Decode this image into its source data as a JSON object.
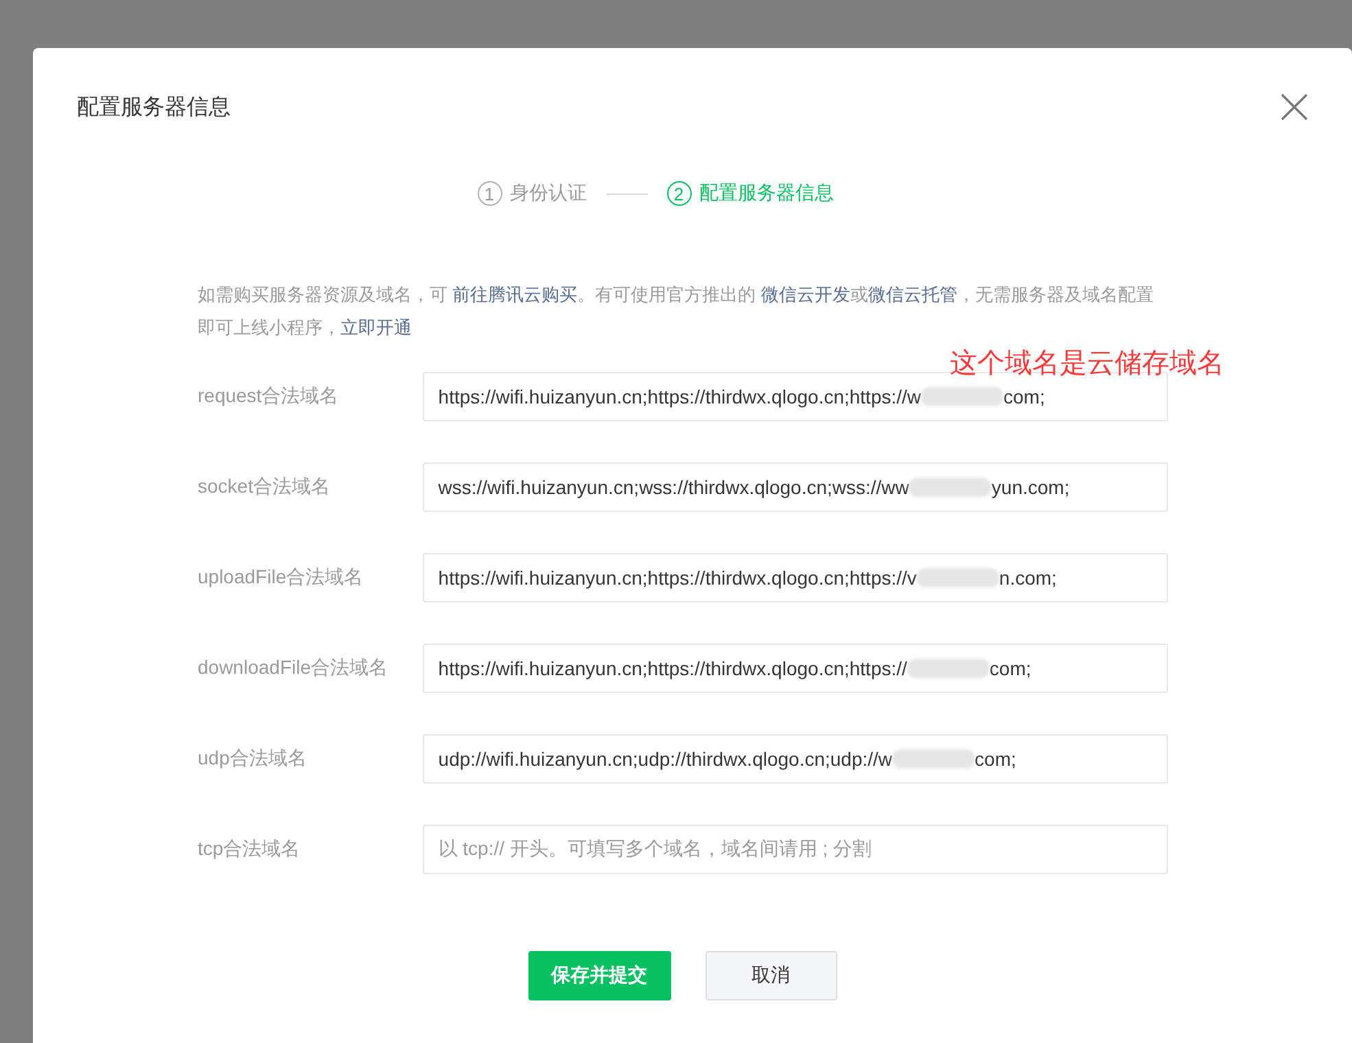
{
  "dialog": {
    "title": "配置服务器信息",
    "steps": [
      {
        "number": "1",
        "label": "身份认证",
        "selected": false
      },
      {
        "number": "2",
        "label": "配置服务器信息",
        "selected": true
      }
    ],
    "notice": [
      {
        "kind": "text",
        "text": "如需购买服务器资源及域名，可 "
      },
      {
        "kind": "link",
        "text": "前往腾讯云购买"
      },
      {
        "kind": "text",
        "text": "。有可使用官方推出的 "
      },
      {
        "kind": "link",
        "text": "微信云开发"
      },
      {
        "kind": "text",
        "text": "或"
      },
      {
        "kind": "link",
        "text": "微信云托管"
      },
      {
        "kind": "text",
        "text": "，无需服务器及域名配置即可上线小程序，"
      },
      {
        "kind": "link",
        "text": "立即开通"
      }
    ],
    "fields": [
      {
        "label": "request合法域名",
        "value_start": "https://wifi.huizanyun.cn;https://thirdwx.qlogo.cn;https://w",
        "value_end": "com;"
      },
      {
        "label": "socket合法域名",
        "value_start": "wss://wifi.huizanyun.cn;wss://thirdwx.qlogo.cn;wss://ww",
        "value_end": "yun.com;"
      },
      {
        "label": "uploadFile合法域名",
        "value_start": "https://wifi.huizanyun.cn;https://thirdwx.qlogo.cn;https://v",
        "value_end": "n.com;"
      },
      {
        "label": "downloadFile合法域名",
        "value_start": "https://wifi.huizanyun.cn;https://thirdwx.qlogo.cn;https://",
        "value_end": "com;"
      },
      {
        "label": "udp合法域名",
        "value_start": "udp://wifi.huizanyun.cn;udp://thirdwx.qlogo.cn;udp://w",
        "value_end": "com;"
      },
      {
        "label": "tcp合法域名",
        "placeholder": "以 tcp:// 开头。可填写多个域名，域名间请用 ; 分割"
      }
    ],
    "buttons": [
      {
        "label": "保存并提交",
        "kind": "primary"
      },
      {
        "label": "取消",
        "kind": "secondary"
      }
    ]
  },
  "annotation": "这个域名是云储存域名"
}
